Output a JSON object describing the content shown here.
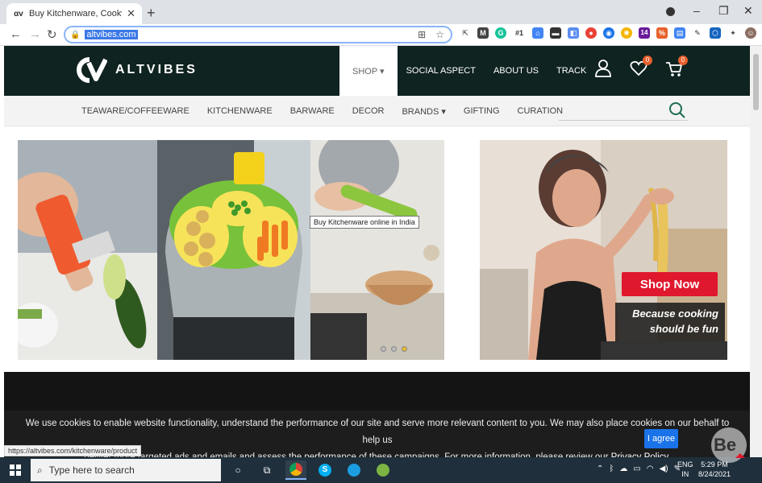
{
  "browser": {
    "tab_title": "Buy Kitchenware, Cookware Ute",
    "tab_favicon": "αv",
    "url": "altvibes.com",
    "status_url": "https://altvibes.com/kitchenware/product",
    "extension_badge": "#1",
    "extension_count": "14"
  },
  "site": {
    "brand": "ALTVIBES",
    "main_nav": [
      {
        "label": "SHOP ▾"
      },
      {
        "label": "SOCIAL ASPECT"
      },
      {
        "label": "ABOUT US"
      },
      {
        "label": "TRACK"
      }
    ],
    "wishlist_count": "0",
    "cart_count": "0",
    "sub_nav": [
      {
        "label": "TEAWARE/COFFEEWARE"
      },
      {
        "label": "KITCHENWARE"
      },
      {
        "label": "BARWARE"
      },
      {
        "label": "DECOR"
      },
      {
        "label": "BRANDS ▾"
      },
      {
        "label": "GIFTING"
      },
      {
        "label": "CURATION"
      }
    ]
  },
  "hero": {
    "tooltip": "Buy Kitchenware online in India",
    "shop_now": "Shop Now",
    "tagline_1": "Because cooking",
    "tagline_2": "should be fun",
    "carousel_active_index": 2
  },
  "cookie": {
    "message_1": "We use cookies to enable website functionality, understand the performance of our site and serve more relevant content to you. We may also place cookies on our behalf to help us",
    "message_2": "deliver more targeted ads and emails and assess the performance of these campaigns. For more information, please review our",
    "policy_link": "Privacy Policy.",
    "agree": "I agree"
  },
  "taskbar": {
    "search_placeholder": "Type here to search",
    "lang_1": "ENG",
    "lang_2": "IN",
    "time": "5:29 PM",
    "date": "8/24/2021"
  },
  "colors": {
    "header_bg": "#0f2321",
    "accent_red": "#e0182d",
    "badge_orange": "#e8602c",
    "taskbar_bg": "#1f2f3c"
  }
}
